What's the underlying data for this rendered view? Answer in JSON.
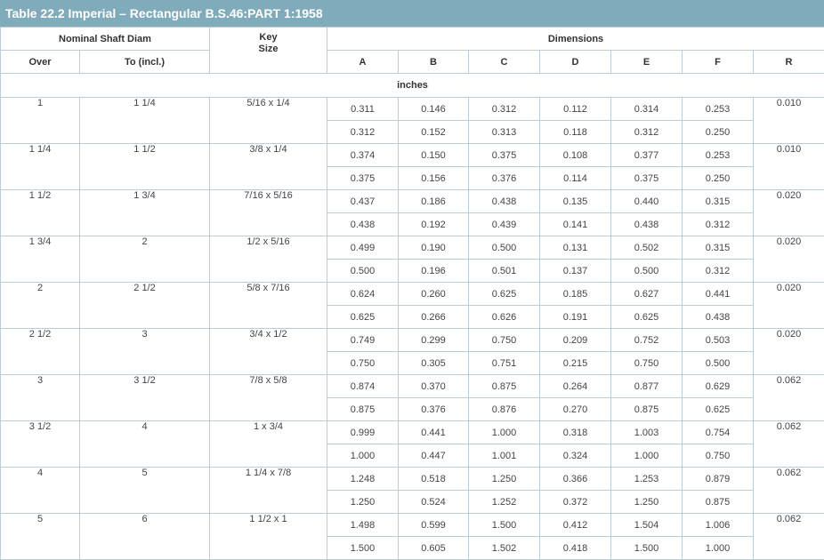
{
  "title": "Table 22.2 Imperial – Rectangular B.S.46:PART 1:1958",
  "headers": {
    "nominal_shaft_diam": "Nominal Shaft Diam",
    "key_size": "Key Size",
    "dimensions": "Dimensions",
    "over": "Over",
    "to_incl": "To (incl.)",
    "columns": [
      "A",
      "B",
      "C",
      "D",
      "E",
      "F",
      "R"
    ]
  },
  "units": "inches",
  "rows": [
    {
      "over": "1",
      "to": "1 1/4",
      "key": "5/16 x 1/4",
      "r": "0.010",
      "a": [
        "0.311",
        "0.146",
        "0.312",
        "0.112",
        "0.314",
        "0.253"
      ],
      "b": [
        "0.312",
        "0.152",
        "0.313",
        "0.118",
        "0.312",
        "0.250"
      ]
    },
    {
      "over": "1 1/4",
      "to": "1 1/2",
      "key": "3/8 x 1/4",
      "r": "0.010",
      "a": [
        "0.374",
        "0.150",
        "0.375",
        "0.108",
        "0.377",
        "0.253"
      ],
      "b": [
        "0.375",
        "0.156",
        "0.376",
        "0.114",
        "0.375",
        "0.250"
      ]
    },
    {
      "over": "1 1/2",
      "to": "1 3/4",
      "key": "7/16 x 5/16",
      "r": "0.020",
      "a": [
        "0.437",
        "0.186",
        "0.438",
        "0.135",
        "0.440",
        "0.315"
      ],
      "b": [
        "0.438",
        "0.192",
        "0.439",
        "0.141",
        "0.438",
        "0.312"
      ]
    },
    {
      "over": "1 3/4",
      "to": "2",
      "key": "1/2 x 5/16",
      "r": "0.020",
      "a": [
        "0.499",
        "0.190",
        "0.500",
        "0.131",
        "0.502",
        "0.315"
      ],
      "b": [
        "0.500",
        "0.196",
        "0.501",
        "0.137",
        "0.500",
        "0.312"
      ]
    },
    {
      "over": "2",
      "to": "2 1/2",
      "key": "5/8 x 7/16",
      "r": "0.020",
      "a": [
        "0.624",
        "0.260",
        "0.625",
        "0.185",
        "0.627",
        "0.441"
      ],
      "b": [
        "0.625",
        "0.266",
        "0.626",
        "0.191",
        "0.625",
        "0.438"
      ]
    },
    {
      "over": "2 1/2",
      "to": "3",
      "key": "3/4 x 1/2",
      "r": "0.020",
      "a": [
        "0.749",
        "0.299",
        "0.750",
        "0.209",
        "0.752",
        "0.503"
      ],
      "b": [
        "0.750",
        "0.305",
        "0.751",
        "0.215",
        "0.750",
        "0.500"
      ]
    },
    {
      "over": "3",
      "to": "3 1/2",
      "key": "7/8 x 5/8",
      "r": "0.062",
      "a": [
        "0.874",
        "0.370",
        "0.875",
        "0.264",
        "0.877",
        "0.629"
      ],
      "b": [
        "0.875",
        "0.376",
        "0.876",
        "0.270",
        "0.875",
        "0.625"
      ]
    },
    {
      "over": "3 1/2",
      "to": "4",
      "key": "1 x 3/4",
      "r": "0.062",
      "a": [
        "0.999",
        "0.441",
        "1.000",
        "0.318",
        "1.003",
        "0.754"
      ],
      "b": [
        "1.000",
        "0.447",
        "1.001",
        "0.324",
        "1.000",
        "0.750"
      ]
    },
    {
      "over": "4",
      "to": "5",
      "key": "1 1/4 x 7/8",
      "r": "0.062",
      "a": [
        "1.248",
        "0.518",
        "1.250",
        "0.366",
        "1.253",
        "0.879"
      ],
      "b": [
        "1.250",
        "0.524",
        "1.252",
        "0.372",
        "1.250",
        "0.875"
      ]
    },
    {
      "over": "5",
      "to": "6",
      "key": "1 1/2 x 1",
      "r": "0.062",
      "a": [
        "1.498",
        "0.599",
        "1.500",
        "0.412",
        "1.504",
        "1.006"
      ],
      "b": [
        "1.500",
        "0.605",
        "1.502",
        "0.418",
        "1.500",
        "1.000"
      ]
    }
  ]
}
